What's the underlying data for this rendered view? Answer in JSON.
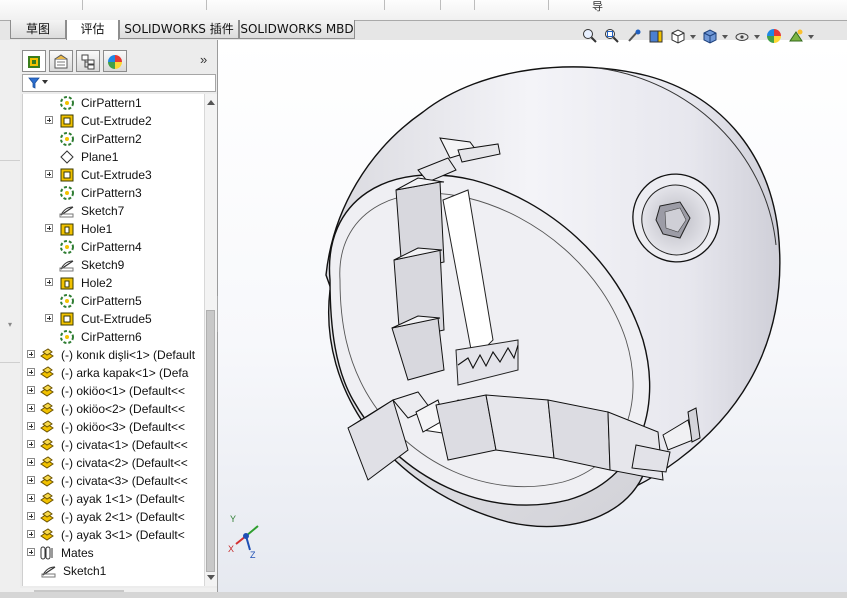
{
  "topstrip": {
    "fragment": "导"
  },
  "command_tabs": [
    {
      "label": "草图"
    },
    {
      "label": "评估"
    },
    {
      "label": "SOLIDWORKS 插件"
    },
    {
      "label": "SOLIDWORKS MBD"
    }
  ],
  "feature_manager": {
    "panel_tabs": [
      {
        "icon": "feature-tree-icon"
      },
      {
        "icon": "property-manager-icon"
      },
      {
        "icon": "configuration-manager-icon"
      },
      {
        "icon": "display-manager-icon"
      }
    ],
    "collapse_glyph": "»",
    "tree": [
      {
        "label": "CirPattern1",
        "icon": "circular-pattern-icon",
        "expandable": false
      },
      {
        "label": "Cut-Extrude2",
        "icon": "cut-extrude-icon",
        "expandable": true
      },
      {
        "label": "CirPattern2",
        "icon": "circular-pattern-icon",
        "expandable": false
      },
      {
        "label": "Plane1",
        "icon": "plane-icon",
        "expandable": false
      },
      {
        "label": "Cut-Extrude3",
        "icon": "cut-extrude-icon",
        "expandable": true
      },
      {
        "label": "CirPattern3",
        "icon": "circular-pattern-icon",
        "expandable": false
      },
      {
        "label": "Sketch7",
        "icon": "sketch-icon",
        "expandable": false
      },
      {
        "label": "Hole1",
        "icon": "hole-icon",
        "expandable": true
      },
      {
        "label": "CirPattern4",
        "icon": "circular-pattern-icon",
        "expandable": false
      },
      {
        "label": "Sketch9",
        "icon": "sketch-icon",
        "expandable": false
      },
      {
        "label": "Hole2",
        "icon": "hole-icon",
        "expandable": true
      },
      {
        "label": "CirPattern5",
        "icon": "circular-pattern-icon",
        "expandable": false
      },
      {
        "label": "Cut-Extrude5",
        "icon": "cut-extrude-icon",
        "expandable": true
      },
      {
        "label": "CirPattern6",
        "icon": "circular-pattern-icon",
        "expandable": false
      },
      {
        "label": "(-) konık dişli<1> (Default",
        "icon": "part-icon",
        "expandable": true
      },
      {
        "label": "(-) arka kapak<1> (Defa",
        "icon": "part-icon",
        "expandable": true
      },
      {
        "label": "(-) okiöo<1> (Default<<",
        "icon": "part-icon",
        "expandable": true
      },
      {
        "label": "(-) okiöo<2> (Default<<",
        "icon": "part-icon",
        "expandable": true
      },
      {
        "label": "(-) okiöo<3> (Default<<",
        "icon": "part-icon",
        "expandable": true
      },
      {
        "label": "(-) civata<1> (Default<<",
        "icon": "part-icon",
        "expandable": true
      },
      {
        "label": "(-) civata<2> (Default<<",
        "icon": "part-icon",
        "expandable": true
      },
      {
        "label": "(-) civata<3> (Default<<",
        "icon": "part-icon",
        "expandable": true
      },
      {
        "label": "(-) ayak 1<1> (Default<",
        "icon": "part-icon",
        "expandable": true
      },
      {
        "label": "(-) ayak 2<1> (Default<",
        "icon": "part-icon",
        "expandable": true
      },
      {
        "label": "(-) ayak 3<1> (Default<",
        "icon": "part-icon",
        "expandable": true
      },
      {
        "label": "Mates",
        "icon": "mates-icon",
        "expandable": true
      },
      {
        "label": "Sketch1",
        "icon": "sketch-icon",
        "expandable": false
      }
    ]
  },
  "heads_up_toolbar": [
    "zoom-to-fit-icon",
    "zoom-to-area-icon",
    "previous-view-icon",
    "section-view-icon",
    "view-orientation-icon",
    "display-style-icon",
    "hide-show-items-icon",
    "edit-appearance-icon",
    "apply-scene-icon"
  ],
  "triad": {
    "x": "X",
    "y": "Y",
    "z": "Z"
  },
  "colors": {
    "accent": "#2060c0",
    "pattern_green": "#2e7d32",
    "part_yellow": "#e0b400"
  }
}
